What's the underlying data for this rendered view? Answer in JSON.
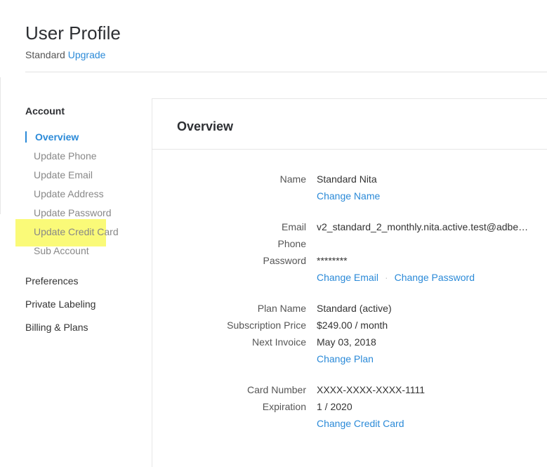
{
  "header": {
    "title": "User Profile",
    "plan_label": "Standard",
    "upgrade_link": "Upgrade"
  },
  "sidebar": {
    "account_heading": "Account",
    "account_items": [
      {
        "label": "Overview",
        "active": true
      },
      {
        "label": "Update Phone"
      },
      {
        "label": "Update Email"
      },
      {
        "label": "Update Address"
      },
      {
        "label": "Update Password"
      },
      {
        "label": "Update Credit Card"
      },
      {
        "label": "Sub Account"
      }
    ],
    "preferences": "Preferences",
    "private_labeling": "Private Labeling",
    "billing_plans": "Billing & Plans",
    "highlight_color": "#fafa78",
    "accent_color": "#2b8ad8"
  },
  "overview": {
    "title": "Overview",
    "name_label": "Name",
    "name_value": "Standard Nita",
    "change_name": "Change Name",
    "email_label": "Email",
    "email_value": "v2_standard_2_monthly.nita.active.test@adbe…",
    "phone_label": "Phone",
    "phone_value": "",
    "password_label": "Password",
    "password_value": "********",
    "change_email": "Change Email",
    "separator": "·",
    "change_password": "Change Password",
    "plan_name_label": "Plan Name",
    "plan_name_value": "Standard (active)",
    "subscription_price_label": "Subscription Price",
    "subscription_price_value": "$249.00 / month",
    "next_invoice_label": "Next Invoice",
    "next_invoice_value": "May 03, 2018",
    "change_plan": "Change Plan",
    "card_number_label": "Card Number",
    "card_number_value": "XXXX-XXXX-XXXX-1111",
    "expiration_label": "Expiration",
    "expiration_value": "1 / 2020",
    "change_credit_card": "Change Credit Card"
  }
}
